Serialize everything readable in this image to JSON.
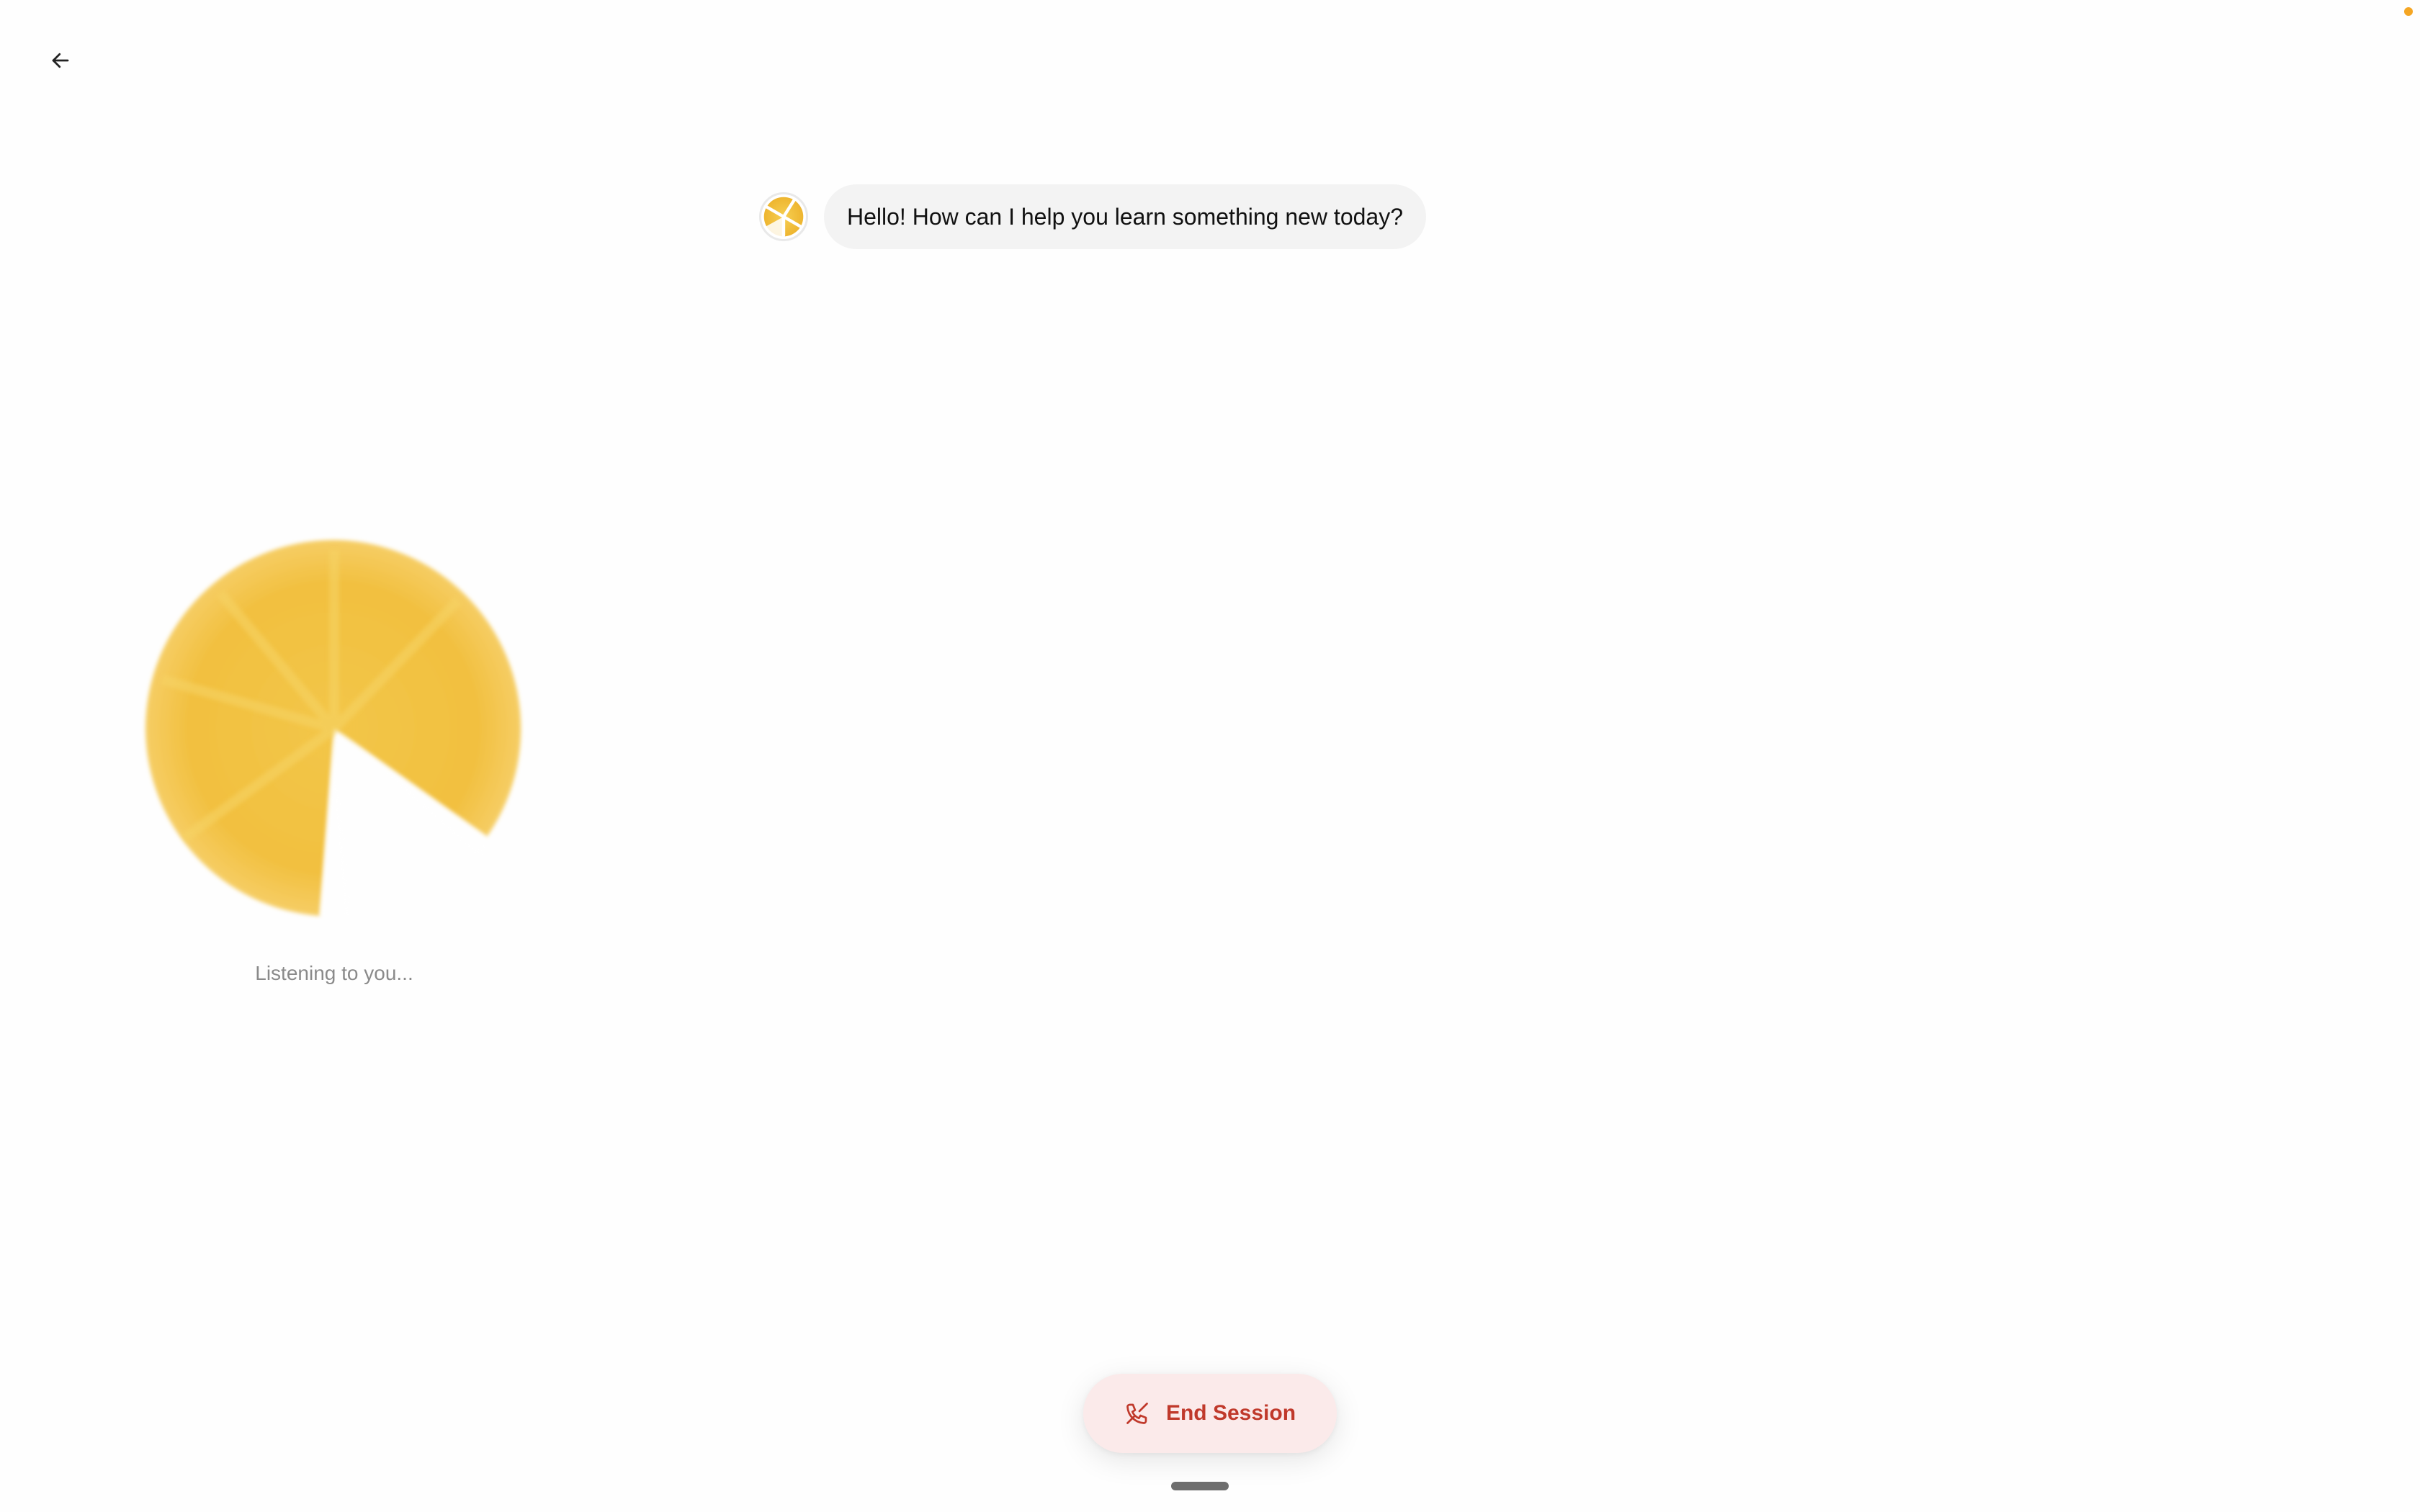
{
  "header": {
    "back_icon": "arrow-left-icon"
  },
  "status": {
    "indicator_color": "#f5a623"
  },
  "conversation": {
    "messages": [
      {
        "role": "assistant",
        "avatar_icon": "citrus-slice-icon",
        "text": "Hello! How can I help you learn something new today?"
      }
    ]
  },
  "voice": {
    "orb_icon": "citrus-orb",
    "orb_color": "#f4c242",
    "status_text": "Listening to you..."
  },
  "controls": {
    "end_session_label": "End Session",
    "end_session_icon": "phone-off-icon",
    "accent_color": "#c0392b"
  }
}
